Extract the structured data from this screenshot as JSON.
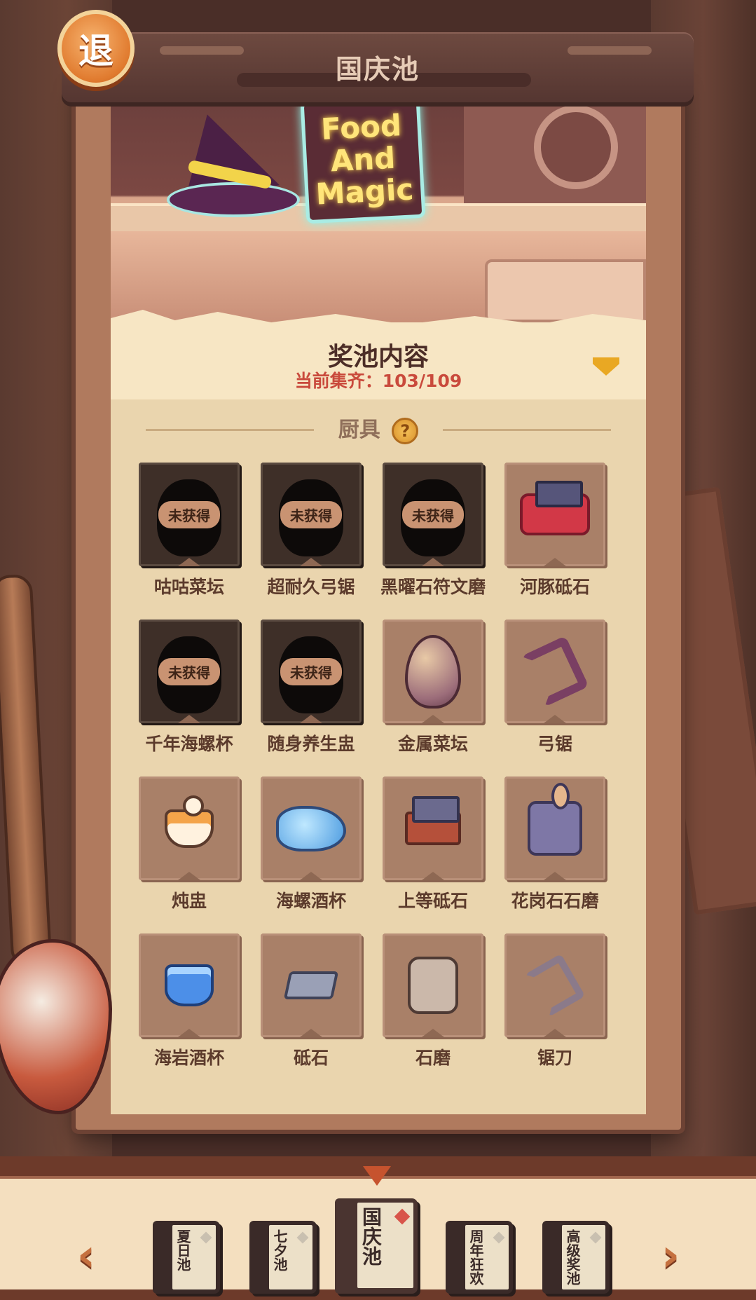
{
  "header": {
    "exit_label": "退",
    "title": "国庆池"
  },
  "banner": {
    "sign_lines": [
      "Food",
      "And",
      "Magic"
    ]
  },
  "pool": {
    "title": "奖池内容",
    "progress": "当前集齐：103/109"
  },
  "section": {
    "title": "厨具",
    "help_label": "?"
  },
  "locked_label": "未获得",
  "items": [
    {
      "name": "咕咕菜坛",
      "locked": true
    },
    {
      "name": "超耐久弓锯",
      "locked": true
    },
    {
      "name": "黑曜石符文磨",
      "locked": true
    },
    {
      "name": "河豚砥石",
      "locked": false,
      "icon": "red-oven"
    },
    {
      "name": "千年海螺杯",
      "locked": true
    },
    {
      "name": "随身养生盅",
      "locked": true
    },
    {
      "name": "金属菜坛",
      "locked": false,
      "icon": "egg-jar"
    },
    {
      "name": "弓锯",
      "locked": false,
      "icon": "bow-saw"
    },
    {
      "name": "炖盅",
      "locked": false,
      "icon": "stew-pot"
    },
    {
      "name": "海螺酒杯",
      "locked": false,
      "icon": "shell-cup"
    },
    {
      "name": "上等砥石",
      "locked": false,
      "icon": "whetstone"
    },
    {
      "name": "花岗石石磨",
      "locked": false,
      "icon": "granite-mill"
    },
    {
      "name": "海岩酒杯",
      "locked": false,
      "icon": "rock-cup"
    },
    {
      "name": "砥石",
      "locked": false,
      "icon": "stone"
    },
    {
      "name": "石磨",
      "locked": false,
      "icon": "stone-mill"
    },
    {
      "name": "锯刀",
      "locked": false,
      "icon": "saw-blade"
    }
  ],
  "bottom_nav": {
    "prev_label": "‹",
    "next_label": "›",
    "books": [
      {
        "label": "夏日池",
        "active": false
      },
      {
        "label": "七夕池",
        "active": false
      },
      {
        "label": "国庆池",
        "active": true
      },
      {
        "label": "周年狂欢",
        "active": false
      },
      {
        "label": "高级奖池",
        "active": false
      }
    ]
  }
}
